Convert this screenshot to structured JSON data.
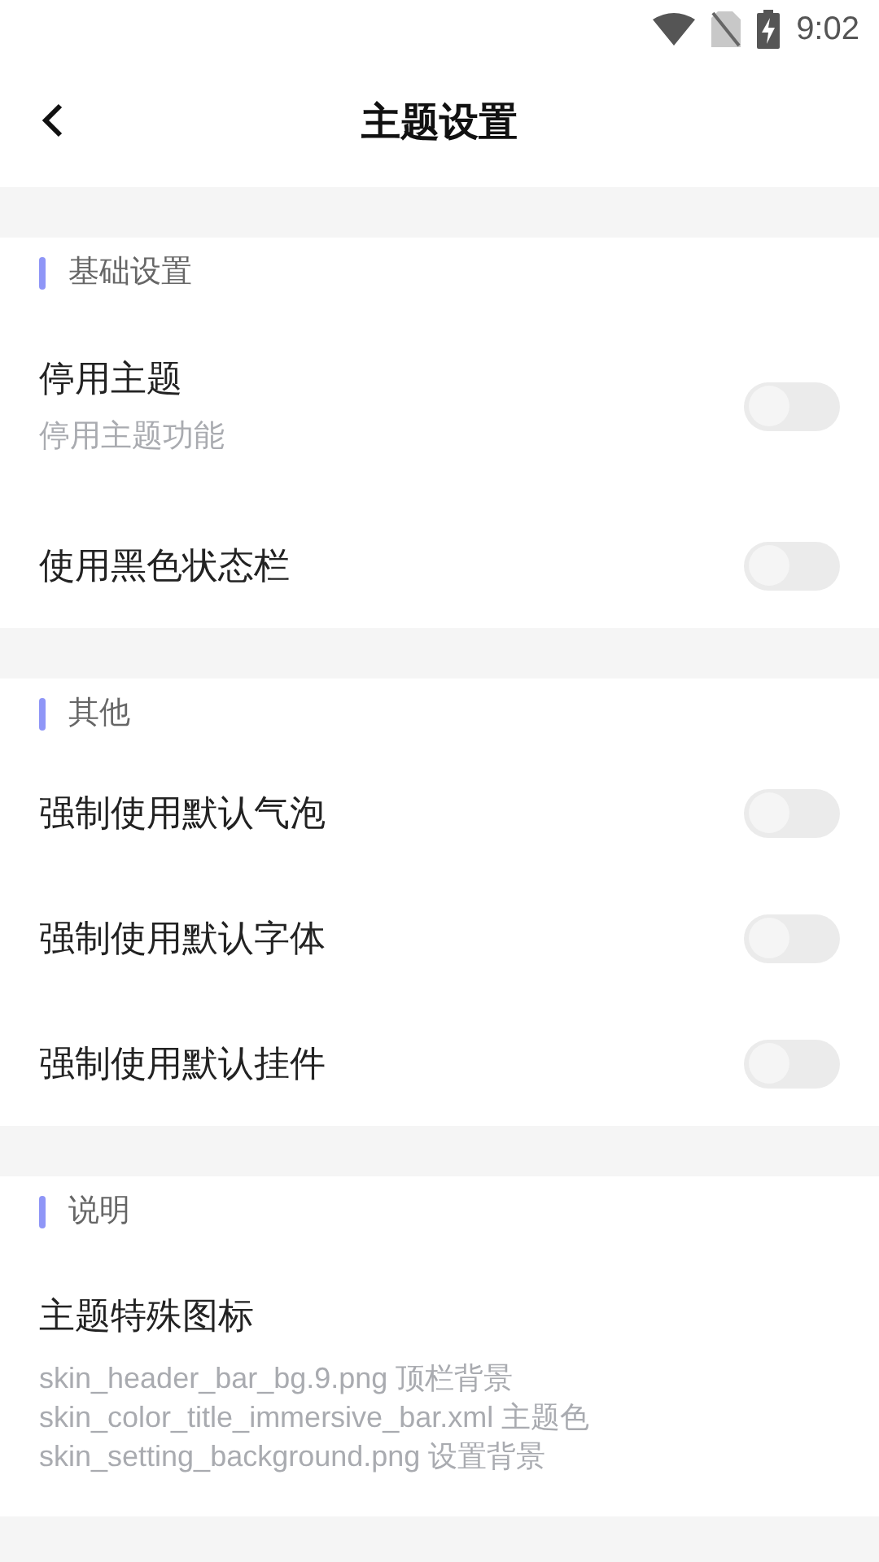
{
  "status_bar": {
    "time": "9:02"
  },
  "header": {
    "title": "主题设置"
  },
  "sections": [
    {
      "title": "基础设置",
      "items": [
        {
          "kind": "switch",
          "title": "停用主题",
          "subtitle": "停用主题功能",
          "on": false
        },
        {
          "kind": "switch",
          "title": "使用黑色状态栏",
          "on": false
        }
      ]
    },
    {
      "title": "其他",
      "items": [
        {
          "kind": "switch",
          "title": "强制使用默认气泡",
          "on": false
        },
        {
          "kind": "switch",
          "title": "强制使用默认字体",
          "on": false
        },
        {
          "kind": "switch",
          "title": "强制使用默认挂件",
          "on": false
        }
      ]
    },
    {
      "title": "说明",
      "items": [
        {
          "kind": "info",
          "title": "主题特殊图标",
          "lines": [
            "skin_header_bar_bg.9.png 顶栏背景",
            "skin_color_title_immersive_bar.xml 主题色",
            "skin_setting_background.png 设置背景"
          ]
        }
      ]
    }
  ]
}
